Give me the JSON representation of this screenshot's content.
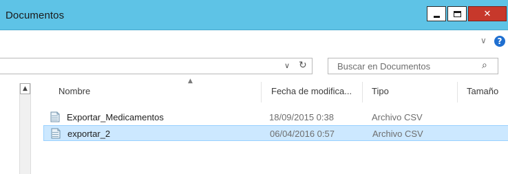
{
  "window": {
    "title": "Documentos"
  },
  "search": {
    "placeholder": "Buscar en Documentos"
  },
  "columns": {
    "name": "Nombre",
    "date": "Fecha de modifica...",
    "type": "Tipo",
    "size": "Tamaño"
  },
  "files": [
    {
      "name": "Exportar_Medicamentos",
      "date": "18/09/2015 0:38",
      "type": "Archivo CSV",
      "selected": false
    },
    {
      "name": "exportar_2",
      "date": "06/04/2016 0:57",
      "type": "Archivo CSV",
      "selected": true
    }
  ],
  "icons": {
    "minimize": "minimize-icon",
    "maximize": "maximize-icon",
    "close": "close-icon",
    "help": "help-icon",
    "search": "search-icon",
    "refresh": "refresh-icon",
    "file": "csv-file-icon"
  },
  "colors": {
    "titlebar": "#5ec3e6",
    "close_button": "#c7382b",
    "selection": "#cce8ff",
    "selection_border": "#99d1ff"
  }
}
